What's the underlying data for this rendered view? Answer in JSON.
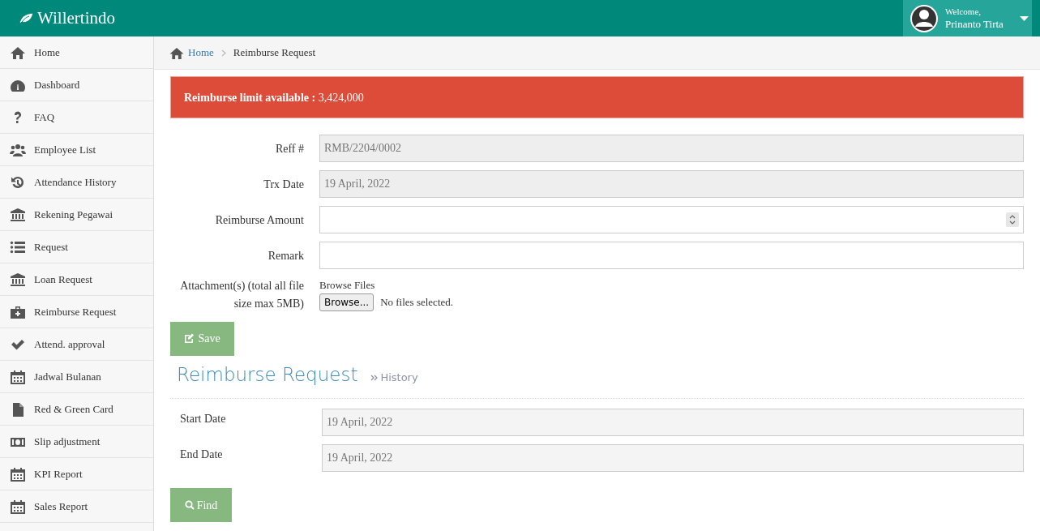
{
  "brand": "Willertindo",
  "user": {
    "greeting": "Welcome,",
    "name": "Prinanto Tirta"
  },
  "sidebar": {
    "items": [
      {
        "label": "Home"
      },
      {
        "label": "Dashboard"
      },
      {
        "label": "FAQ"
      },
      {
        "label": "Employee List"
      },
      {
        "label": "Attendance History"
      },
      {
        "label": "Rekening Pegawai"
      },
      {
        "label": "Request"
      },
      {
        "label": "Loan Request"
      },
      {
        "label": "Reimburse Request"
      },
      {
        "label": "Attend. approval"
      },
      {
        "label": "Jadwal Bulanan"
      },
      {
        "label": "Red & Green Card"
      },
      {
        "label": "Slip adjustment"
      },
      {
        "label": "KPI Report"
      },
      {
        "label": "Sales Report"
      }
    ]
  },
  "breadcrumb": [
    "Home",
    "Reimburse Request"
  ],
  "alert": "**Reimburse limit available :** 3,424,000",
  "form": {
    "fields": [
      {
        "label": "Reff #",
        "kind": "readonly",
        "value": "RMB/2204/0002"
      },
      {
        "label": "Trx Date",
        "kind": "readonly",
        "value": "19 April, 2022"
      },
      {
        "label": "Reimburse Amount",
        "kind": "number"
      },
      {
        "label": "Remark",
        "kind": "text"
      },
      {
        "label": "Attachment(s) (total all file size max 5MB)",
        "kind": "file",
        "caption": "Browse Files",
        "button": "Browse...",
        "status": "No files selected."
      }
    ],
    "save_button": "Save"
  },
  "history": {
    "title": "Reimburse Request",
    "subtitle": "History",
    "fields": [
      {
        "label": "Start Date",
        "value": "19 April, 2022"
      },
      {
        "label": "End Date",
        "value": "19 April, 2022"
      }
    ],
    "find_button": "Find"
  }
}
